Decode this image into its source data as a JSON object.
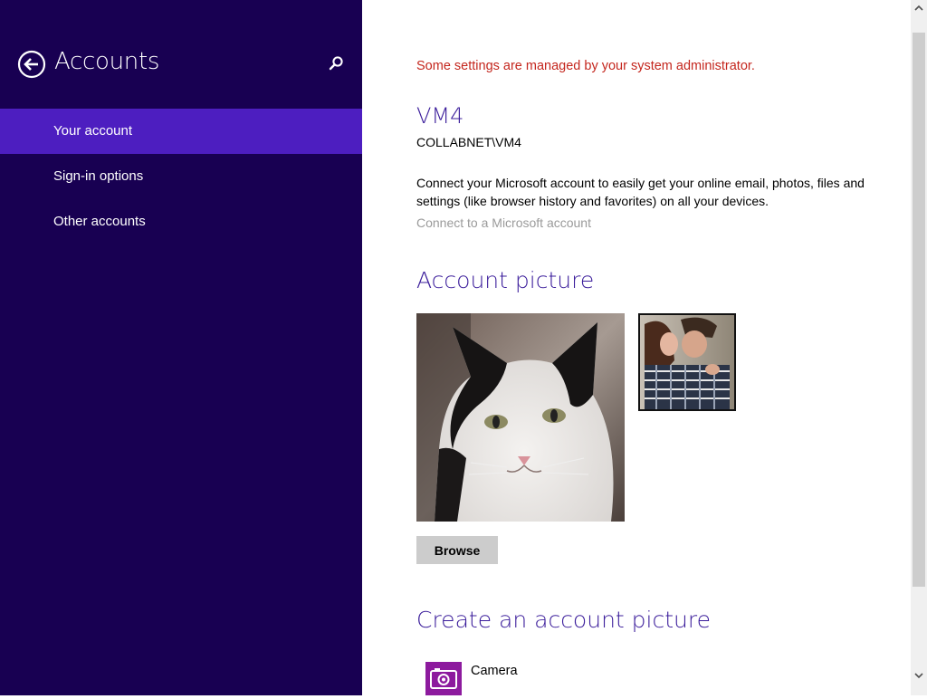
{
  "app": {
    "title": "Accounts"
  },
  "nav": {
    "items": [
      {
        "label": "Your account",
        "active": true
      },
      {
        "label": "Sign-in options",
        "active": false
      },
      {
        "label": "Other accounts",
        "active": false
      }
    ]
  },
  "main": {
    "admin_note": "Some settings are managed by your system administrator.",
    "account_name": "VM4",
    "account_domain": "COLLABNET\\VM4",
    "description": "Connect your Microsoft account to easily get your online email, photos, files and settings (like browser history and favorites) on all your devices.",
    "connect_link": "Connect to a Microsoft account",
    "picture_heading": "Account picture",
    "browse_label": "Browse",
    "create_heading": "Create an account picture",
    "camera_label": "Camera"
  },
  "colors": {
    "sidebar_bg": "#180052",
    "sidebar_active": "#4d1ec0",
    "heading": "#3b1d9b",
    "warning": "#c4261d",
    "camera_tile": "#8d1a9e"
  },
  "icons": {
    "back": "back-arrow-icon",
    "search": "search-icon",
    "camera": "camera-icon"
  }
}
